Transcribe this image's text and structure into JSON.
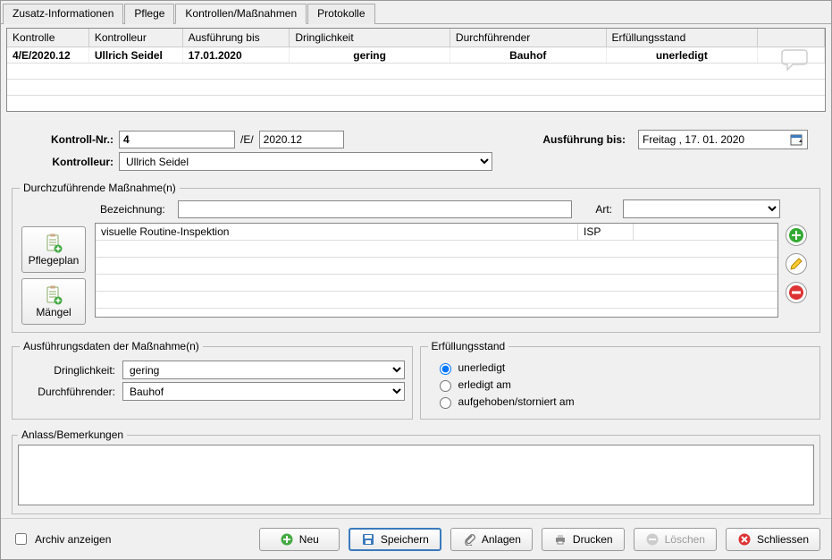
{
  "tabs": [
    {
      "label": "Zusatz-Informationen"
    },
    {
      "label": "Pflege"
    },
    {
      "label": "Kontrollen/Maßnahmen"
    },
    {
      "label": "Protokolle"
    }
  ],
  "activeTab": 2,
  "grid": {
    "headers": {
      "kontrolle": "Kontrolle",
      "kontrolleur": "Kontrolleur",
      "ausfuehrung": "Ausführung bis",
      "dringlichkeit": "Dringlichkeit",
      "durchfuehrender": "Durchführender",
      "erfuellungsstand": "Erfüllungsstand"
    },
    "rows": [
      {
        "kontrolle": "4/E/2020.12",
        "kontrolleur": "Ullrich Seidel",
        "ausfuehrung": "17.01.2020",
        "dringlichkeit": "gering",
        "durchfuehrender": "Bauhof",
        "erfuellungsstand": "unerledigt"
      }
    ]
  },
  "form": {
    "kontrollNrLabel": "Kontroll-Nr.:",
    "kontrollNr": "4",
    "kontrollSep": "/E/",
    "kontrollDate": "2020.12",
    "kontrolleurLabel": "Kontrolleur:",
    "kontrolleur": "Ullrich Seidel",
    "ausfuehrungBisLabel": "Ausführung bis:",
    "ausfuehrungDate": "Freitag   , 17. 01. 2020"
  },
  "massnahmen": {
    "legend": "Durchzuführende Maßnahme(n)",
    "bezLabel": "Bezeichnung:",
    "bezValue": "",
    "artLabel": "Art:",
    "artValue": "",
    "pflegeplanLabel": "Pflegeplan",
    "maengelLabel": "Mängel",
    "rows": [
      {
        "bez": "visuelle Routine-Inspektion",
        "art": "ISP",
        "extra": ""
      }
    ]
  },
  "ausfuehrung": {
    "legend": "Ausführungsdaten der Maßnahme(n)",
    "dringLabel": "Dringlichkeit:",
    "dringValue": "gering",
    "durchLabel": "Durchführender:",
    "durchValue": "Bauhof"
  },
  "erfuellung": {
    "legend": "Erfüllungsstand",
    "opt1": "unerledigt",
    "opt2": "erledigt am",
    "opt3": "aufgehoben/storniert am",
    "selected": 0
  },
  "anlass": {
    "legend": "Anlass/Bemerkungen",
    "text": ""
  },
  "footer": {
    "archiv": "Archiv anzeigen",
    "neu": "Neu",
    "speichern": "Speichern",
    "anlagen": "Anlagen",
    "drucken": "Drucken",
    "loeschen": "Löschen",
    "schliessen": "Schliessen"
  }
}
